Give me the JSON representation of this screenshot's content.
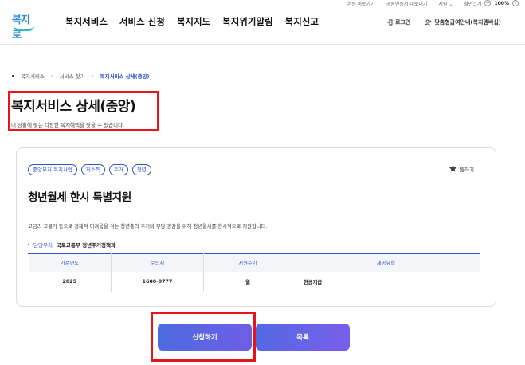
{
  "util_bar": {
    "items": [
      "본문 바로가기",
      "공동인증서 내보내기",
      "지원 ⌄"
    ],
    "zoom_label": "화면크기",
    "zoom_minus": "−",
    "zoom_value": "100%",
    "zoom_plus": "+"
  },
  "header": {
    "logo_text": "복지로",
    "nav": [
      "복지서비스",
      "서비스 신청",
      "복지지도",
      "복지위기알림",
      "복지신고"
    ],
    "login_label": "로그인",
    "membership_label": "맞춤형급여안내(복지멤버십)"
  },
  "breadcrumb": [
    "복지서비스",
    "서비스 찾기",
    "복지서비스 상세(중앙)"
  ],
  "page": {
    "title": "복지서비스 상세(중앙)",
    "description": "내 상황에 맞는 다양한 복지혜택을 찾을 수 있습니다."
  },
  "service": {
    "tags": [
      "중앙부처 복지사업",
      "저소득",
      "주거",
      "청년"
    ],
    "bookmark_label": "찜하기",
    "title": "청년월세 한시 특별지원",
    "summary": "고금리·고물가 등으로 경제적 어려움을 겪는 청년층의 주거비 부담 경감을 위해 청년월세를 한시적으로 지원합니다.",
    "dept_label": "담당부처",
    "dept_value": "국토교통부 청년주거정책과",
    "table": {
      "headers": [
        "기준연도",
        "문의처",
        "지원주기",
        "제공유형"
      ],
      "row": [
        "2025",
        "1600-0777",
        "월",
        "현금지급"
      ]
    }
  },
  "actions": {
    "apply_label": "신청하기",
    "list_label": "목록"
  },
  "colors": {
    "accent": "#2f55c8",
    "highlight": "#e8141c"
  }
}
